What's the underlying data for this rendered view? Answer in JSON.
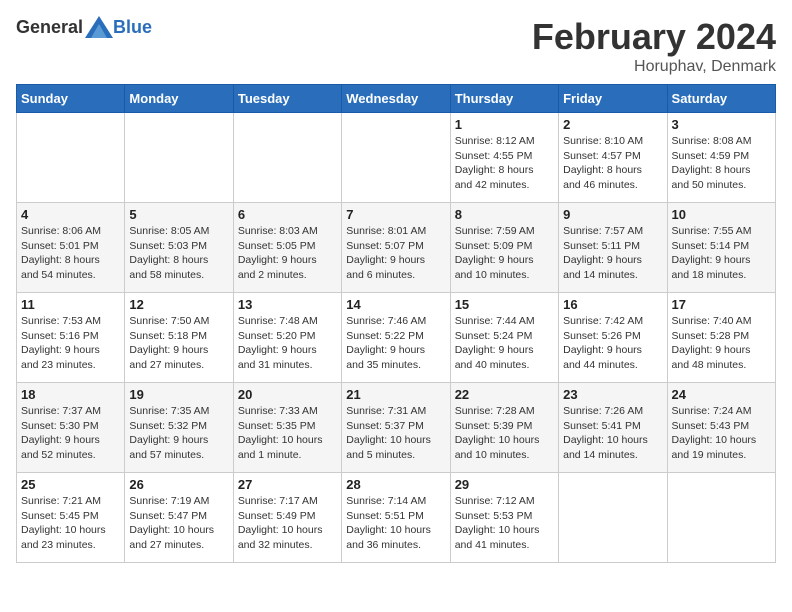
{
  "header": {
    "logo_general": "General",
    "logo_blue": "Blue",
    "month": "February 2024",
    "location": "Horuphav, Denmark"
  },
  "weekdays": [
    "Sunday",
    "Monday",
    "Tuesday",
    "Wednesday",
    "Thursday",
    "Friday",
    "Saturday"
  ],
  "weeks": [
    [
      {
        "day": "",
        "info": ""
      },
      {
        "day": "",
        "info": ""
      },
      {
        "day": "",
        "info": ""
      },
      {
        "day": "",
        "info": ""
      },
      {
        "day": "1",
        "info": "Sunrise: 8:12 AM\nSunset: 4:55 PM\nDaylight: 8 hours\nand 42 minutes."
      },
      {
        "day": "2",
        "info": "Sunrise: 8:10 AM\nSunset: 4:57 PM\nDaylight: 8 hours\nand 46 minutes."
      },
      {
        "day": "3",
        "info": "Sunrise: 8:08 AM\nSunset: 4:59 PM\nDaylight: 8 hours\nand 50 minutes."
      }
    ],
    [
      {
        "day": "4",
        "info": "Sunrise: 8:06 AM\nSunset: 5:01 PM\nDaylight: 8 hours\nand 54 minutes."
      },
      {
        "day": "5",
        "info": "Sunrise: 8:05 AM\nSunset: 5:03 PM\nDaylight: 8 hours\nand 58 minutes."
      },
      {
        "day": "6",
        "info": "Sunrise: 8:03 AM\nSunset: 5:05 PM\nDaylight: 9 hours\nand 2 minutes."
      },
      {
        "day": "7",
        "info": "Sunrise: 8:01 AM\nSunset: 5:07 PM\nDaylight: 9 hours\nand 6 minutes."
      },
      {
        "day": "8",
        "info": "Sunrise: 7:59 AM\nSunset: 5:09 PM\nDaylight: 9 hours\nand 10 minutes."
      },
      {
        "day": "9",
        "info": "Sunrise: 7:57 AM\nSunset: 5:11 PM\nDaylight: 9 hours\nand 14 minutes."
      },
      {
        "day": "10",
        "info": "Sunrise: 7:55 AM\nSunset: 5:14 PM\nDaylight: 9 hours\nand 18 minutes."
      }
    ],
    [
      {
        "day": "11",
        "info": "Sunrise: 7:53 AM\nSunset: 5:16 PM\nDaylight: 9 hours\nand 23 minutes."
      },
      {
        "day": "12",
        "info": "Sunrise: 7:50 AM\nSunset: 5:18 PM\nDaylight: 9 hours\nand 27 minutes."
      },
      {
        "day": "13",
        "info": "Sunrise: 7:48 AM\nSunset: 5:20 PM\nDaylight: 9 hours\nand 31 minutes."
      },
      {
        "day": "14",
        "info": "Sunrise: 7:46 AM\nSunset: 5:22 PM\nDaylight: 9 hours\nand 35 minutes."
      },
      {
        "day": "15",
        "info": "Sunrise: 7:44 AM\nSunset: 5:24 PM\nDaylight: 9 hours\nand 40 minutes."
      },
      {
        "day": "16",
        "info": "Sunrise: 7:42 AM\nSunset: 5:26 PM\nDaylight: 9 hours\nand 44 minutes."
      },
      {
        "day": "17",
        "info": "Sunrise: 7:40 AM\nSunset: 5:28 PM\nDaylight: 9 hours\nand 48 minutes."
      }
    ],
    [
      {
        "day": "18",
        "info": "Sunrise: 7:37 AM\nSunset: 5:30 PM\nDaylight: 9 hours\nand 52 minutes."
      },
      {
        "day": "19",
        "info": "Sunrise: 7:35 AM\nSunset: 5:32 PM\nDaylight: 9 hours\nand 57 minutes."
      },
      {
        "day": "20",
        "info": "Sunrise: 7:33 AM\nSunset: 5:35 PM\nDaylight: 10 hours\nand 1 minute."
      },
      {
        "day": "21",
        "info": "Sunrise: 7:31 AM\nSunset: 5:37 PM\nDaylight: 10 hours\nand 5 minutes."
      },
      {
        "day": "22",
        "info": "Sunrise: 7:28 AM\nSunset: 5:39 PM\nDaylight: 10 hours\nand 10 minutes."
      },
      {
        "day": "23",
        "info": "Sunrise: 7:26 AM\nSunset: 5:41 PM\nDaylight: 10 hours\nand 14 minutes."
      },
      {
        "day": "24",
        "info": "Sunrise: 7:24 AM\nSunset: 5:43 PM\nDaylight: 10 hours\nand 19 minutes."
      }
    ],
    [
      {
        "day": "25",
        "info": "Sunrise: 7:21 AM\nSunset: 5:45 PM\nDaylight: 10 hours\nand 23 minutes."
      },
      {
        "day": "26",
        "info": "Sunrise: 7:19 AM\nSunset: 5:47 PM\nDaylight: 10 hours\nand 27 minutes."
      },
      {
        "day": "27",
        "info": "Sunrise: 7:17 AM\nSunset: 5:49 PM\nDaylight: 10 hours\nand 32 minutes."
      },
      {
        "day": "28",
        "info": "Sunrise: 7:14 AM\nSunset: 5:51 PM\nDaylight: 10 hours\nand 36 minutes."
      },
      {
        "day": "29",
        "info": "Sunrise: 7:12 AM\nSunset: 5:53 PM\nDaylight: 10 hours\nand 41 minutes."
      },
      {
        "day": "",
        "info": ""
      },
      {
        "day": "",
        "info": ""
      }
    ]
  ]
}
